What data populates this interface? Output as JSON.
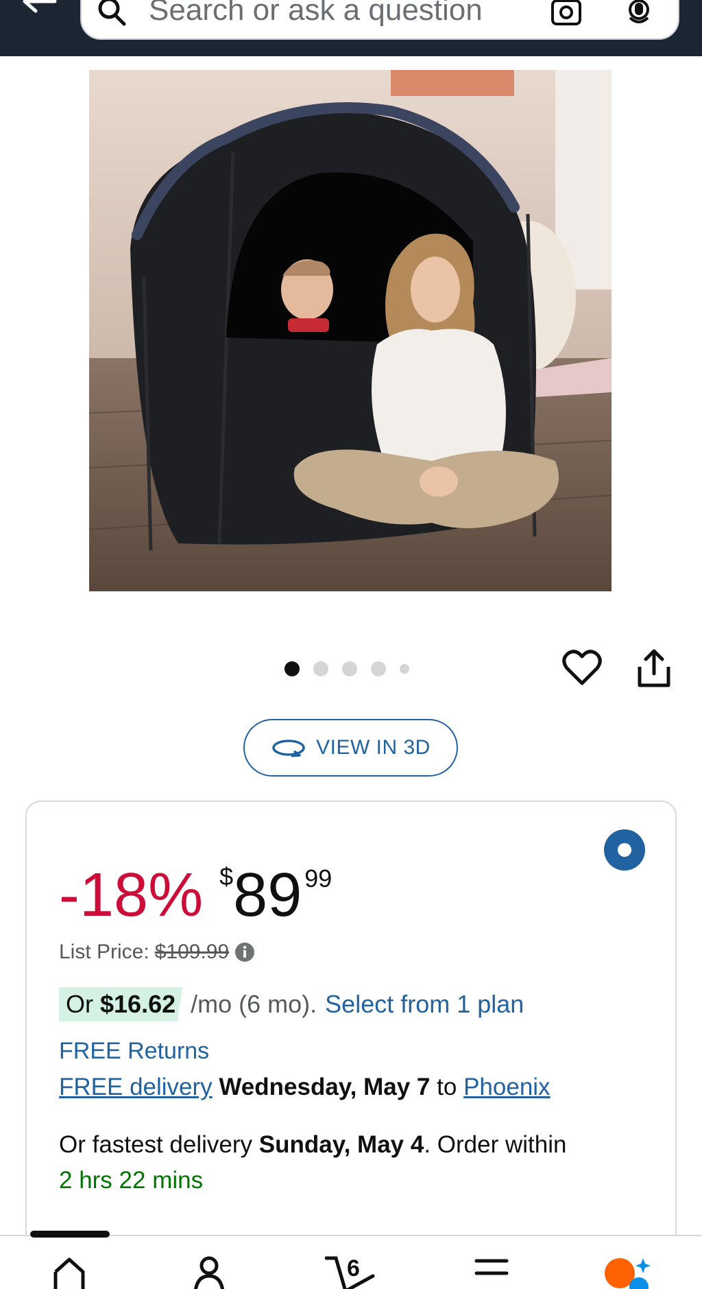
{
  "header": {
    "search_placeholder": "Search or ask a question"
  },
  "product": {
    "image_alt": "Black pop-up tent in a living room with a baby inside and a woman sitting in front",
    "carousel": {
      "total": 5,
      "active": 1
    }
  },
  "actions": {
    "view_3d_label": "VIEW IN 3D"
  },
  "buybox": {
    "discount": "-18%",
    "currency": "$",
    "price_whole": "89",
    "price_fraction": "99",
    "list_price_label": "List Price:",
    "list_price_value": "$109.99",
    "installment_prefix": "Or",
    "installment_amount": "$16.62",
    "installment_term": "/mo (6 mo).",
    "installment_link": "Select from 1 plan",
    "free_returns": "FREE Returns",
    "free_delivery": "FREE delivery",
    "delivery_date": "Wednesday, May 7",
    "delivery_to": "to",
    "delivery_location": "Phoenix",
    "fastest_prefix": "Or fastest delivery",
    "fastest_date": "Sunday, May 4",
    "fastest_suffix": ". Order within",
    "countdown": "2 hrs 22 mins"
  },
  "bottom_nav": {
    "cart_count": "6"
  },
  "colors": {
    "header_bg": "#1c2532",
    "link": "#2162a1",
    "discount": "#cc0c39",
    "countdown": "#007600",
    "installment_highlight": "#d4f1e3"
  }
}
